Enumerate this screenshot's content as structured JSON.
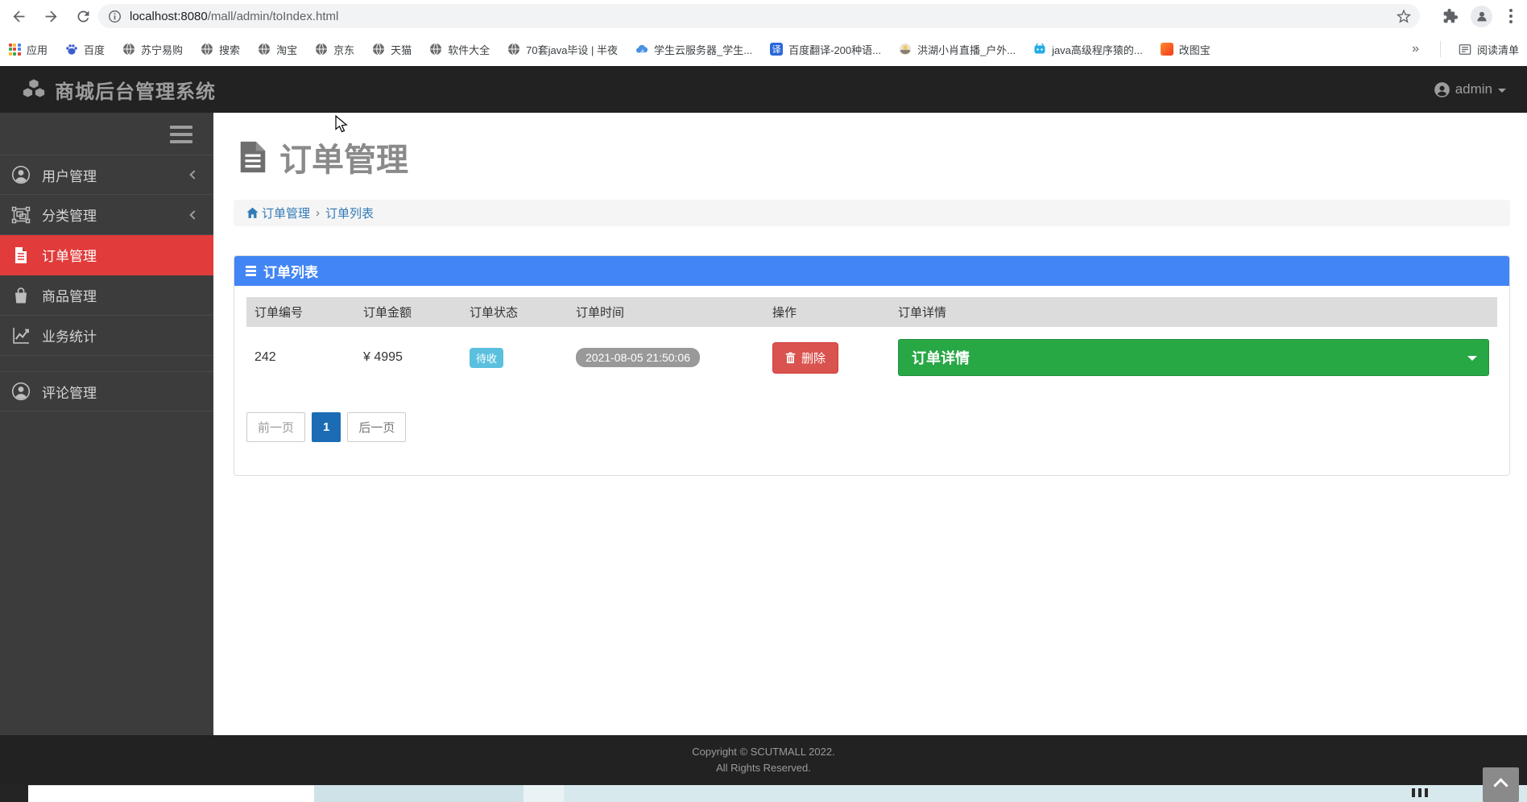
{
  "browser": {
    "url_host": "localhost:8080",
    "url_path": "/mall/admin/toIndex.html",
    "bookmarks": [
      {
        "label": "应用",
        "icon": "apps-grid"
      },
      {
        "label": "百度",
        "icon": "baidu-paw"
      },
      {
        "label": "苏宁易购",
        "icon": "globe"
      },
      {
        "label": "搜索",
        "icon": "globe"
      },
      {
        "label": "淘宝",
        "icon": "globe"
      },
      {
        "label": "京东",
        "icon": "globe"
      },
      {
        "label": "天猫",
        "icon": "globe"
      },
      {
        "label": "软件大全",
        "icon": "globe"
      },
      {
        "label": "70套java毕设 | 半夜",
        "icon": "globe"
      },
      {
        "label": "学生云服务器_学生...",
        "icon": "cloud"
      },
      {
        "label": "百度翻译-200种语...",
        "icon": "translate-badge",
        "badge_char": "译"
      },
      {
        "label": "洪湖小肖直播_户外...",
        "icon": "live-avatar"
      },
      {
        "label": "java高级程序猿的...",
        "icon": "tv-bilibili"
      },
      {
        "label": "改图宝",
        "icon": "image-edit"
      }
    ],
    "overflow": "»",
    "reading_list": "阅读清单"
  },
  "navbar": {
    "title": "商城后台管理系统",
    "user": "admin"
  },
  "sidebar": {
    "items": [
      {
        "label": "用户管理",
        "icon": "user-circle"
      },
      {
        "label": "分类管理",
        "icon": "object-group"
      },
      {
        "label": "订单管理",
        "icon": "file-text"
      },
      {
        "label": "商品管理",
        "icon": "shopping-bag"
      },
      {
        "label": "业务统计",
        "icon": "line-chart"
      },
      {
        "label": "评论管理",
        "icon": "user-circle"
      }
    ]
  },
  "page": {
    "title": "订单管理",
    "breadcrumb": {
      "home": "订单管理",
      "separator": "›",
      "current": "订单列表"
    },
    "panel_title": "订单列表",
    "table": {
      "headers": [
        "订单编号",
        "订单金额",
        "订单状态",
        "订单时间",
        "操作",
        "订单详情"
      ],
      "rows": [
        {
          "order_id": "242",
          "amount": "¥ 4995",
          "status": "待收",
          "time": "2021-08-05 21:50:06",
          "delete_label": "删除",
          "detail_label": "订单详情"
        }
      ]
    },
    "pagination": {
      "prev": "前一页",
      "current": "1",
      "next": "后一页"
    }
  },
  "footer": {
    "line1": "Copyright © SCUTMALL 2022.",
    "line2": "All Rights Reserved."
  },
  "colors": {
    "navbar_bg": "#222222",
    "sidebar_bg": "#3c3c3c",
    "sidebar_active_red": "#e23b3b",
    "panel_header_blue": "#4285f4",
    "status_badge_blue": "#5bc0de",
    "time_badge_gray": "#999999",
    "delete_red": "#d9534f",
    "detail_green": "#28a745",
    "pagination_active_blue": "#1b6cb5",
    "link_blue": "#337ab7"
  }
}
